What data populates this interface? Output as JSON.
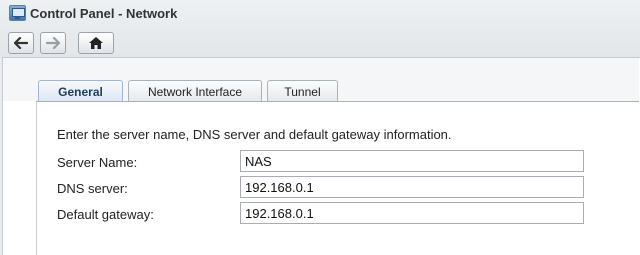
{
  "window": {
    "title": "Control Panel - Network"
  },
  "toolbar": {
    "back_icon": "arrow-left-icon",
    "forward_icon": "arrow-right-icon",
    "home_icon": "home-icon"
  },
  "tabs": [
    {
      "label": "General",
      "active": true
    },
    {
      "label": "Network Interface",
      "active": false
    },
    {
      "label": "Tunnel",
      "active": false
    }
  ],
  "general": {
    "intro": "Enter the server name, DNS server and default gateway information.",
    "fields": [
      {
        "label": "Server Name:",
        "value": "NAS"
      },
      {
        "label": "DNS server:",
        "value": "192.168.0.1"
      },
      {
        "label": "Default gateway:",
        "value": "192.168.0.1"
      }
    ]
  },
  "colors": {
    "active_tab_accent": "#5b98d2",
    "panel_background": "#ffffff"
  }
}
